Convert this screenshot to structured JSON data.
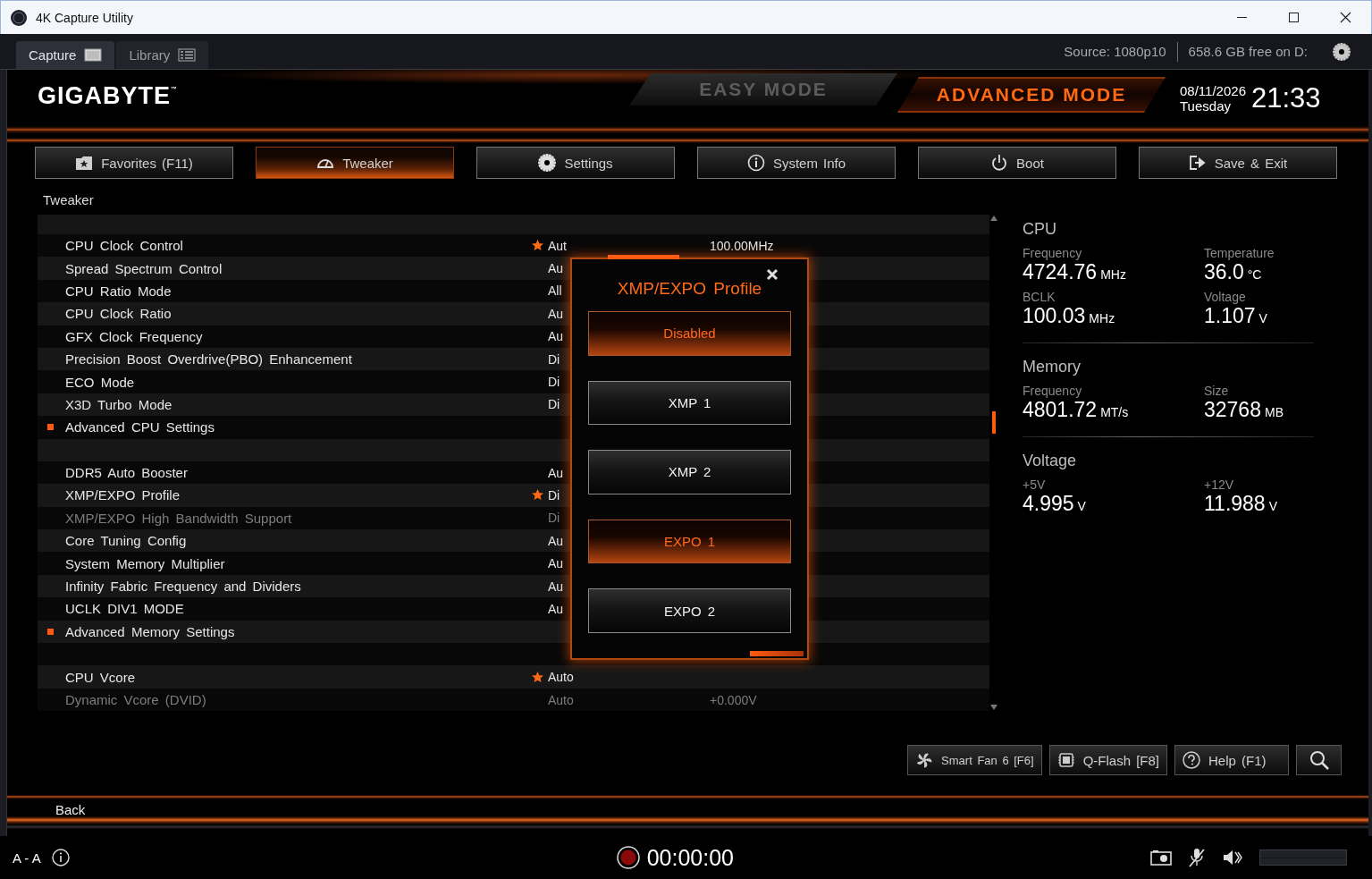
{
  "window": {
    "title": "4K Capture Utility"
  },
  "capture_tabs": [
    {
      "label": "Capture",
      "selected": true
    },
    {
      "label": "Library",
      "selected": false
    }
  ],
  "capture_status": {
    "source": "Source: 1080p10",
    "free_space": "658.6 GB free on D:"
  },
  "bios_header": {
    "brand": "GIGABYTE$^{™}$",
    "modes": [
      {
        "label": "EASY MODE",
        "selected": false
      },
      {
        "label": "ADVANCED MODE",
        "selected": true
      }
    ],
    "date": "08/11/2026",
    "weekday": "Tuesday",
    "time": "21:33"
  },
  "nav_tabs": [
    {
      "label": "Favorites (F11)",
      "selected": false
    },
    {
      "label": "Tweaker",
      "selected": true
    },
    {
      "label": "Settings",
      "selected": false
    },
    {
      "label": "System Info",
      "selected": false
    },
    {
      "label": "Boot",
      "selected": false
    },
    {
      "label": "Save & Exit",
      "selected": false
    }
  ],
  "settings": {
    "title": "Tweaker",
    "groups": [
      {
        "rows": [
          {
            "kind": "setting",
            "label": "CPU Clock Control",
            "favorite": true,
            "disabled": false,
            "value": "Aut",
            "value_2": "100.00MHz"
          },
          {
            "kind": "setting",
            "label": "Spread Spectrum Control",
            "favorite": false,
            "disabled": false,
            "value": "Au"
          },
          {
            "kind": "setting",
            "label": "CPU Ratio Mode",
            "favorite": false,
            "disabled": false,
            "value": "All"
          },
          {
            "kind": "setting",
            "label": "CPU Clock Ratio",
            "favorite": false,
            "disabled": false,
            "value": "Au"
          },
          {
            "kind": "setting",
            "label": "GFX Clock Frequency",
            "favorite": false,
            "disabled": false,
            "value": "Au"
          },
          {
            "kind": "setting",
            "label": "Precision Boost Overdrive(PBO) Enhancement",
            "favorite": false,
            "disabled": false,
            "value": "Di"
          },
          {
            "kind": "setting",
            "label": "ECO Mode",
            "favorite": false,
            "disabled": false,
            "value": "Di"
          },
          {
            "kind": "setting",
            "label": "X3D Turbo Mode",
            "favorite": false,
            "disabled": false,
            "value": "Di"
          },
          {
            "kind": "submenu",
            "label": "Advanced CPU Settings",
            "favorite": false,
            "disabled": false
          }
        ]
      },
      {
        "rows": [
          {
            "kind": "setting",
            "label": "DDR5 Auto Booster",
            "favorite": false,
            "disabled": false,
            "value": "Au"
          },
          {
            "kind": "setting",
            "label": "XMP/EXPO Profile",
            "favorite": true,
            "disabled": false,
            "value": "Di"
          },
          {
            "kind": "setting",
            "label": "XMP/EXPO High Bandwidth Support",
            "favorite": false,
            "disabled": true,
            "value": "Di"
          },
          {
            "kind": "setting",
            "label": "Core Tuning Config",
            "favorite": false,
            "disabled": false,
            "value": "Au"
          },
          {
            "kind": "setting",
            "label": "System Memory Multiplier",
            "favorite": false,
            "disabled": false,
            "value": "Au"
          },
          {
            "kind": "setting",
            "label": "Infinity Fabric Frequency and Dividers",
            "favorite": false,
            "disabled": false,
            "value": "Au"
          },
          {
            "kind": "setting",
            "label": "UCLK DIV1 MODE",
            "favorite": false,
            "disabled": false,
            "value": "Au"
          },
          {
            "kind": "submenu",
            "label": "Advanced Memory Settings",
            "favorite": false,
            "disabled": false
          }
        ]
      },
      {
        "rows": [
          {
            "kind": "setting",
            "label": "CPU Vcore",
            "favorite": true,
            "disabled": false,
            "value": "Auto"
          },
          {
            "kind": "setting",
            "label": "Dynamic Vcore (DVID)",
            "favorite": false,
            "disabled": true,
            "value": "Auto",
            "value_2": "+0.000V"
          }
        ]
      }
    ]
  },
  "profile_dialog": {
    "title": "XMP/EXPO Profile",
    "options": [
      {
        "label": "Disabled",
        "selected": true
      },
      {
        "label": "XMP 1",
        "selected": false
      },
      {
        "label": "XMP 2",
        "selected": false
      },
      {
        "label": "EXPO 1",
        "selected": true
      },
      {
        "label": "EXPO 2",
        "selected": false
      }
    ]
  },
  "hardware_monitor": {
    "sections": [
      {
        "title": "CPU",
        "items": [
          {
            "label": "Frequency",
            "value": "4724.76",
            "unit": "MHz"
          },
          {
            "label": "Temperature",
            "value": "36.0",
            "unit": "°C"
          },
          {
            "label": "BCLK",
            "value": "100.03",
            "unit": "MHz"
          },
          {
            "label": "Voltage",
            "value": "1.107",
            "unit": "V"
          }
        ]
      },
      {
        "title": "Memory",
        "items": [
          {
            "label": "Frequency",
            "value": "4801.72",
            "unit": "MT/s"
          },
          {
            "label": "Size",
            "value": "32768",
            "unit": "MB"
          }
        ]
      },
      {
        "title": "Voltage",
        "items": [
          {
            "label": "+5V",
            "value": "4.995",
            "unit": "V"
          },
          {
            "label": "+12V",
            "value": "11.988",
            "unit": "V"
          }
        ]
      }
    ]
  },
  "footer_buttons": [
    {
      "label": "Smart Fan 6 [F6]"
    },
    {
      "label": "Q-Flash [F8]"
    },
    {
      "label": "Help (F1)"
    }
  ],
  "back": "Back",
  "capture_bar": {
    "channel": "A - A",
    "record_time": "00:00:00"
  }
}
